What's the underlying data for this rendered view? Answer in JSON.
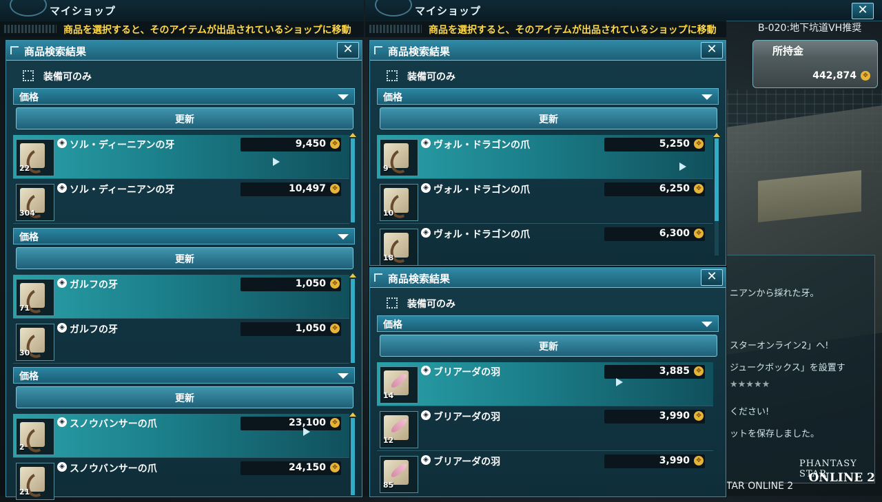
{
  "left_window": {
    "title": "マイショップ",
    "ticker": "商品を選択すると、そのアイテムが出品されているショップに移動"
  },
  "mid_window": {
    "title": "マイショップ",
    "ticker": "商品を選択すると、そのアイテムが出品されているショップに移動"
  },
  "location": "B-020:地下坑道VH推奨",
  "wallet": {
    "label": "所持金",
    "amount": "442,874"
  },
  "close_glyph": "✕",
  "coin_glyph": "✥",
  "mesa_glyph": "◈",
  "panels": {
    "left": {
      "title": "商品検索結果",
      "checkbox_label": "装備可のみ",
      "groups": [
        {
          "sort_label": "価格",
          "update_label": "更新",
          "rows": [
            {
              "name": "ソル・ディーニアンの牙",
              "qty": "22",
              "price": "9,450"
            },
            {
              "name": "ソル・ディーニアンの牙",
              "qty": "304",
              "price": "10,497"
            }
          ]
        },
        {
          "sort_label": "価格",
          "update_label": "更新",
          "rows": [
            {
              "name": "ガルフの牙",
              "qty": "71",
              "price": "1,050"
            },
            {
              "name": "ガルフの牙",
              "qty": "30",
              "price": "1,050"
            }
          ]
        },
        {
          "sort_label": "価格",
          "update_label": "更新",
          "rows": [
            {
              "name": "スノウバンサーの爪",
              "qty": "2",
              "price": "23,100"
            },
            {
              "name": "スノウバンサーの爪",
              "qty": "21",
              "price": "24,150"
            }
          ]
        }
      ]
    },
    "mid_top": {
      "title": "商品検索結果",
      "checkbox_label": "装備可のみ",
      "sort_label": "価格",
      "update_label": "更新",
      "rows": [
        {
          "name": "ヴォル・ドラゴンの爪",
          "qty": "9",
          "price": "5,250"
        },
        {
          "name": "ヴォル・ドラゴンの爪",
          "qty": "10",
          "price": "6,250"
        },
        {
          "name": "ヴォル・ドラゴンの爪",
          "qty": "18",
          "price": "6,300"
        }
      ]
    },
    "mid_bottom": {
      "title": "商品検索結果",
      "checkbox_label": "装備可のみ",
      "sort_label": "価格",
      "update_label": "更新",
      "rows": [
        {
          "name": "ブリアーダの羽",
          "qty": "14",
          "price": "3,885"
        },
        {
          "name": "ブリアーダの羽",
          "qty": "12",
          "price": "3,990"
        },
        {
          "name": "ブリアーダの羽",
          "qty": "85",
          "price": "3,990"
        }
      ]
    }
  },
  "info_lines": [
    "ニアンから採れた牙。",
    "スターオンライン2」へ!",
    "ジュークボックス」を設置す",
    "★★★★★",
    "ください!",
    "ットを保存しました。"
  ],
  "bottom_text": "TAR ONLINE 2",
  "logo": {
    "line1": "PHANTASY STAR",
    "line2": "ONLINE 2"
  }
}
